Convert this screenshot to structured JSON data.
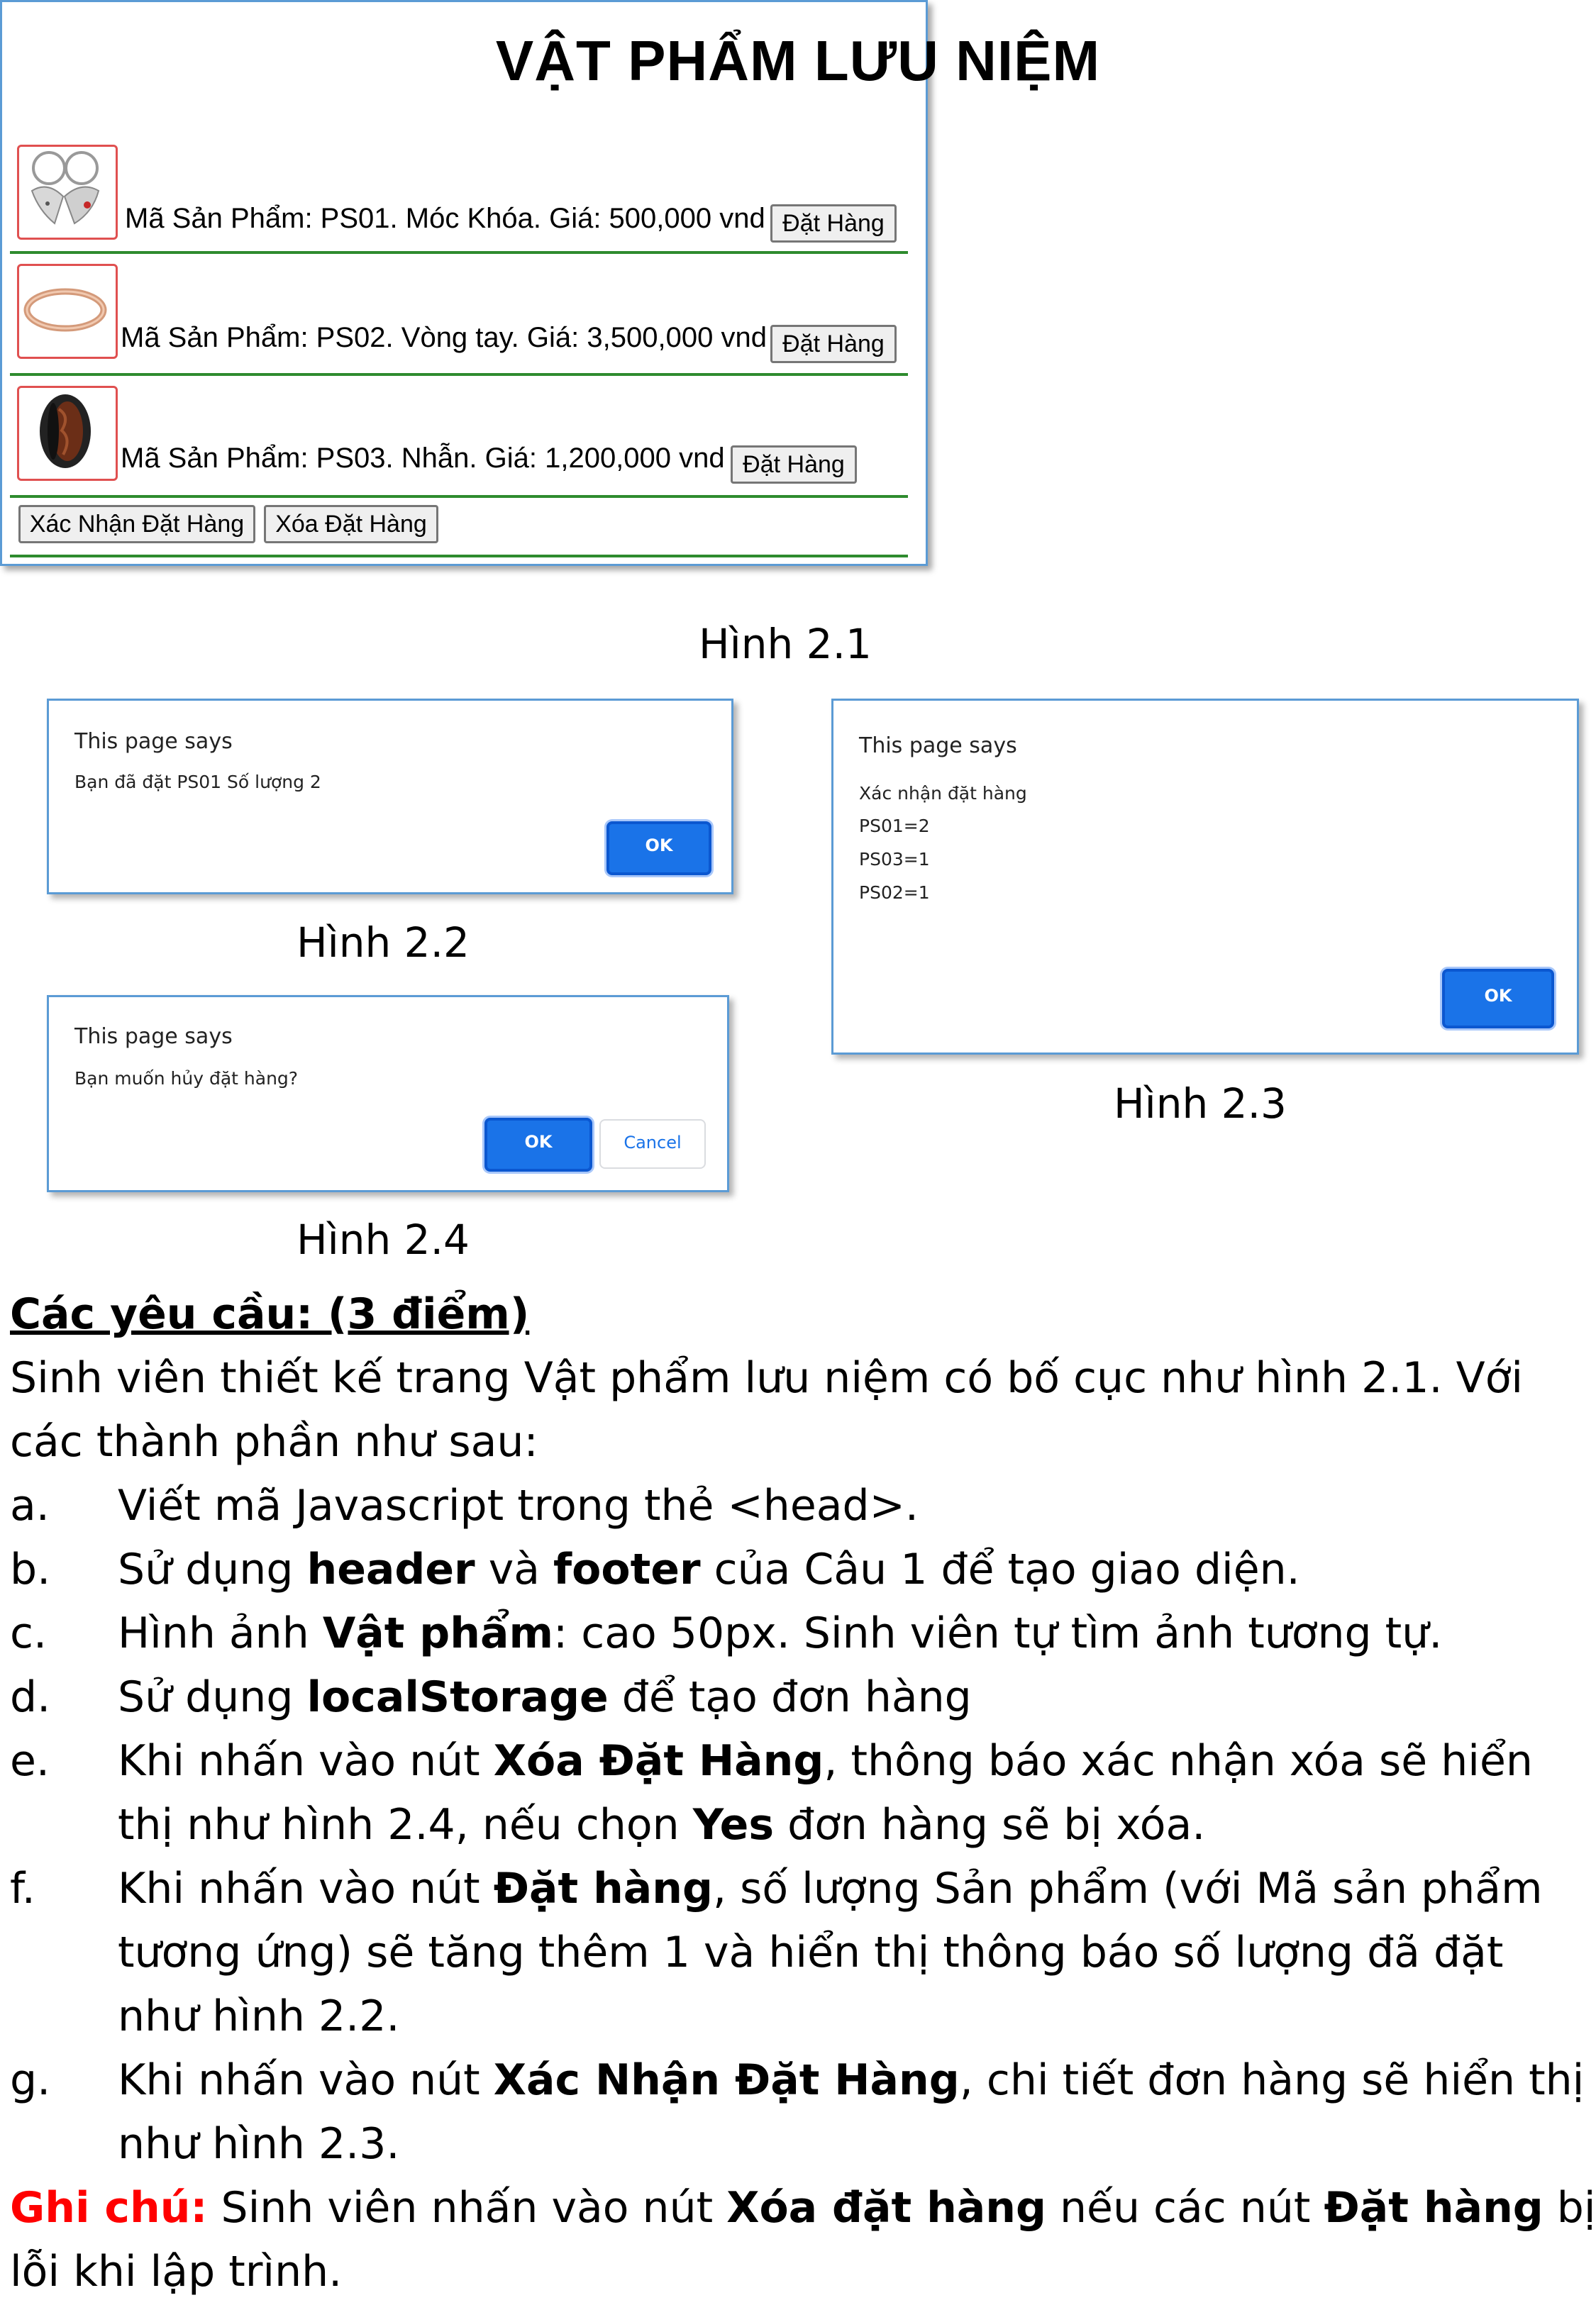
{
  "fig21": {
    "page_title": "VẬT PHẨM LƯU NIỆM",
    "products": [
      {
        "text": "Mã Sản Phẩm: PS01. Móc Khóa. Giá: 500,000 vnd",
        "button": "Đặt Hàng",
        "image_icon": "keychain-image"
      },
      {
        "text": "Mã Sản Phẩm: PS02. Vòng tay. Giá: 3,500,000 vnd",
        "button": "Đặt Hàng",
        "image_icon": "bracelet-image"
      },
      {
        "text": "Mã Sản Phẩm: PS03. Nhẫn. Giá: 1,200,000 vnd",
        "button": "Đặt Hàng",
        "image_icon": "ring-image"
      }
    ],
    "confirm_button": "Xác Nhận Đặt Hàng",
    "delete_button": "Xóa Đặt Hàng",
    "caption": "Hình 2.1"
  },
  "fig22": {
    "title": "This page says",
    "message": "Bạn đã đặt PS01 Số lượng 2",
    "ok": "OK",
    "caption": "Hình 2.2"
  },
  "fig23": {
    "title": "This page says",
    "lines": [
      "Xác nhận đặt hàng",
      "PS01=2",
      "PS03=1",
      "PS02=1"
    ],
    "ok": "OK",
    "caption": "Hình 2.3"
  },
  "fig24": {
    "title": "This page says",
    "message": "Bạn muốn hủy đặt hàng?",
    "ok": "OK",
    "cancel": "Cancel",
    "caption": "Hình 2.4"
  },
  "requirements": {
    "heading": "Các yêu cầu: (3 điểm)",
    "intro_1": "Sinh viên thiết kế trang Vật phẩm lưu niệm có bố cục như hình 2.1. Với",
    "intro_2": "các thành phần như sau:",
    "items": {
      "a": {
        "letter": "a.",
        "t1": "Viết mã Javascript trong thẻ <head>."
      },
      "b": {
        "letter": "b.",
        "t1": "Sử dụng ",
        "b1": "header",
        "t2": " và ",
        "b2": "footer",
        "t3": " của Câu 1 để tạo giao diện."
      },
      "c": {
        "letter": "c.",
        "t1": "Hình ảnh ",
        "b1": "Vật phẩm",
        "t2": ": cao 50px. Sinh viên tự tìm ảnh tương tự."
      },
      "d": {
        "letter": "d.",
        "t1": "Sử dụng ",
        "b1": "localStorage",
        "t2": " để tạo đơn hàng"
      },
      "e": {
        "letter": "e.",
        "t1": "Khi nhấn vào nút ",
        "b1": "Xóa Đặt Hàng",
        "t2": ", thông báo xác nhận xóa sẽ hiển",
        "l2a": "thị như hình 2.4, nếu chọn ",
        "l2b": "Yes",
        "l2c": " đơn hàng sẽ bị xóa."
      },
      "f": {
        "letter": "f.",
        "t1": "Khi nhấn vào nút ",
        "b1": "Đặt hàng",
        "t2": ", số lượng Sản phẩm (với Mã sản phẩm",
        "l2": "tương ứng) sẽ tăng thêm 1 và hiển thị thông báo số lượng đã đặt",
        "l3": "như hình 2.2."
      },
      "g": {
        "letter": "g.",
        "t1": "Khi nhấn vào nút ",
        "b1": "Xác Nhận Đặt Hàng",
        "t2": ", chi tiết đơn hàng sẽ hiển thị",
        "l2": "như hình 2.3."
      }
    },
    "note": {
      "label": "Ghi chú:",
      "t1": " Sinh viên nhấn vào nút ",
      "b1": "Xóa đặt hàng",
      "t2": " nếu các nút ",
      "b2": "Đặt hàng",
      "t3": " bị",
      "l2": "lỗi khi lập trình."
    }
  },
  "colors": {
    "note_red": "#ff0000",
    "dialog_border": "#5b9bd5",
    "ok_blue": "#1a73e8",
    "row_divider": "#2e8b2e"
  }
}
